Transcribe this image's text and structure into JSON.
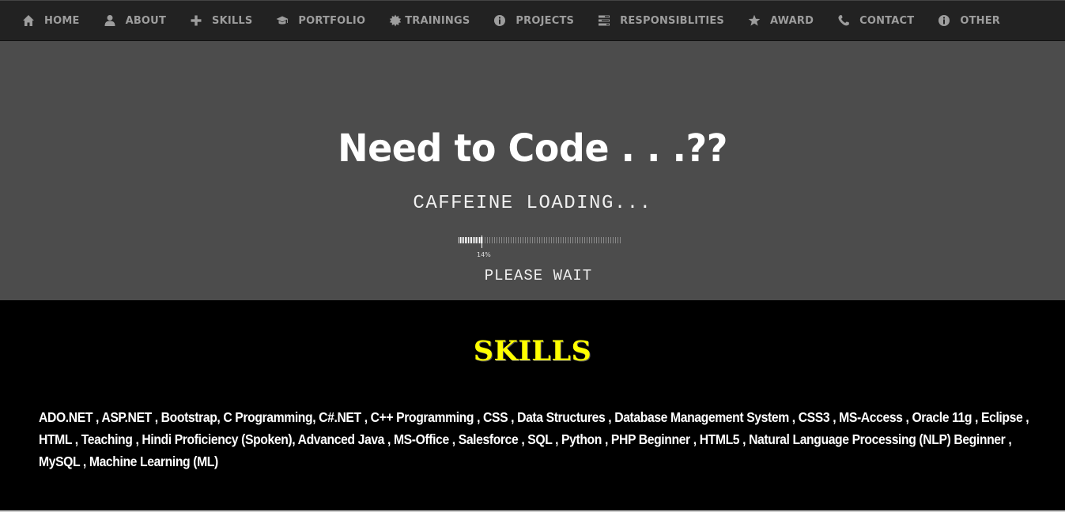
{
  "nav": {
    "items": [
      {
        "label": "HOME",
        "icon": "home-icon"
      },
      {
        "label": "ABOUT",
        "icon": "user-icon"
      },
      {
        "label": "SKILLS",
        "icon": "plus-icon"
      },
      {
        "label": "PORTFOLIO",
        "icon": "graduation-cap-icon"
      },
      {
        "label": "TRAININGS",
        "icon": "certificate-icon"
      },
      {
        "label": "PROJECTS",
        "icon": "info-icon"
      },
      {
        "label": "RESPONSIBLITIES",
        "icon": "tasks-icon"
      },
      {
        "label": "AWARD",
        "icon": "star-icon"
      },
      {
        "label": "CONTACT",
        "icon": "phone-icon"
      },
      {
        "label": "OTHER",
        "icon": "info-icon"
      }
    ]
  },
  "hero": {
    "title": "Need to Code . . .??",
    "subtitle": "CAFFEINE LOADING...",
    "progress_percent": 14,
    "progress_label": "14%",
    "wait_text": "PLEASE WAIT"
  },
  "skills": {
    "title": "SKILLS",
    "text": "ADO.NET , ASP.NET , Bootstrap, C Programming, C#.NET , C++ Programming , CSS , Data Structures , Database Management System , CSS3 , MS-Access , Oracle 11g , Eclipse , HTML , Teaching , Hindi Proficiency (Spoken), Advanced Java , MS-Office , Salesforce , SQL , Python , PHP Beginner , HTML5 , Natural Language Processing (NLP) Beginner , MySQL , Machine Learning (ML)"
  },
  "colors": {
    "nav_bg": "#222222",
    "nav_text": "#9d9d9d",
    "hero_bg": "#4c4c4c",
    "skills_bg": "#000000",
    "skills_title": "#ffff00"
  }
}
